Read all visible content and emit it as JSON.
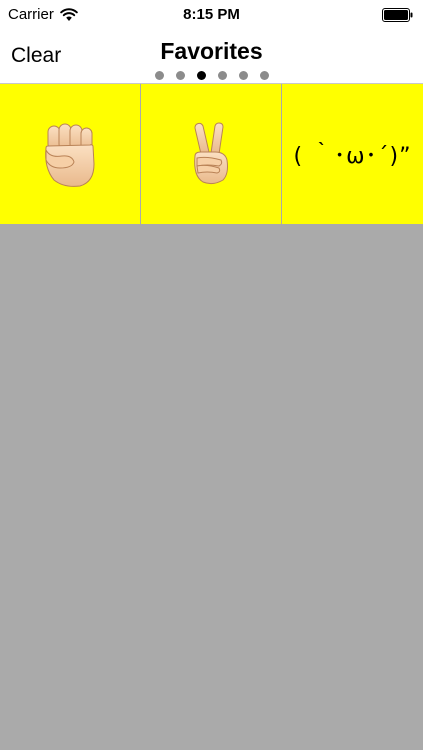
{
  "status_bar": {
    "carrier": "Carrier",
    "time": "8:15 PM"
  },
  "nav": {
    "clear_label": "Clear",
    "title": "Favorites",
    "page_count": 6,
    "active_page": 3
  },
  "favorites": [
    {
      "type": "emoji",
      "icon": "raised-fist-icon"
    },
    {
      "type": "emoji",
      "icon": "victory-hand-icon"
    },
    {
      "type": "kaomoji",
      "text": "( ｀･ω･´)”"
    }
  ],
  "colors": {
    "cell_background": "#ffff00",
    "background": "#aaaaaa"
  }
}
